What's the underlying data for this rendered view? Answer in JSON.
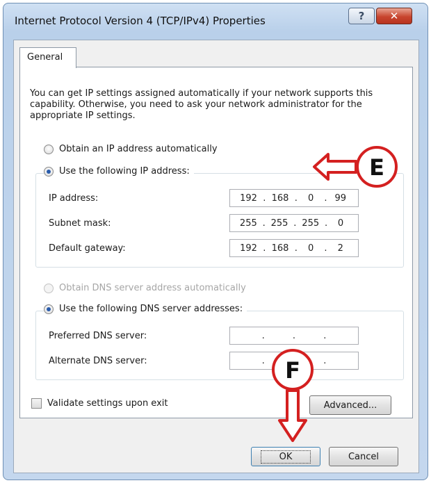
{
  "window": {
    "title": "Internet Protocol Version 4 (TCP/IPv4) Properties",
    "help_label": "?",
    "close_label": "✕"
  },
  "tab": {
    "label": "General"
  },
  "intro": "You can get IP settings assigned automatically if your network supports this capability. Otherwise, you need to ask your network administrator for the appropriate IP settings.",
  "ip": {
    "auto_label": "Obtain an IP address automatically",
    "manual_label": "Use the following IP address:",
    "fields": [
      {
        "label": "IP address:",
        "octets": [
          "192",
          "168",
          "0",
          "99"
        ]
      },
      {
        "label": "Subnet mask:",
        "octets": [
          "255",
          "255",
          "255",
          "0"
        ]
      },
      {
        "label": "Default gateway:",
        "octets": [
          "192",
          "168",
          "0",
          "2"
        ]
      }
    ]
  },
  "dns": {
    "auto_label": "Obtain DNS server address automatically",
    "manual_label": "Use the following DNS server addresses:",
    "fields": [
      {
        "label": "Preferred DNS server:",
        "octets": [
          "",
          "",
          "",
          ""
        ]
      },
      {
        "label": "Alternate DNS server:",
        "octets": [
          "",
          "",
          "",
          ""
        ]
      }
    ]
  },
  "validate_label": "Validate settings upon exit",
  "buttons": {
    "advanced": "Advanced...",
    "ok": "OK",
    "cancel": "Cancel"
  },
  "annotations": {
    "e": "E",
    "f": "F",
    "color": "#d42020"
  }
}
